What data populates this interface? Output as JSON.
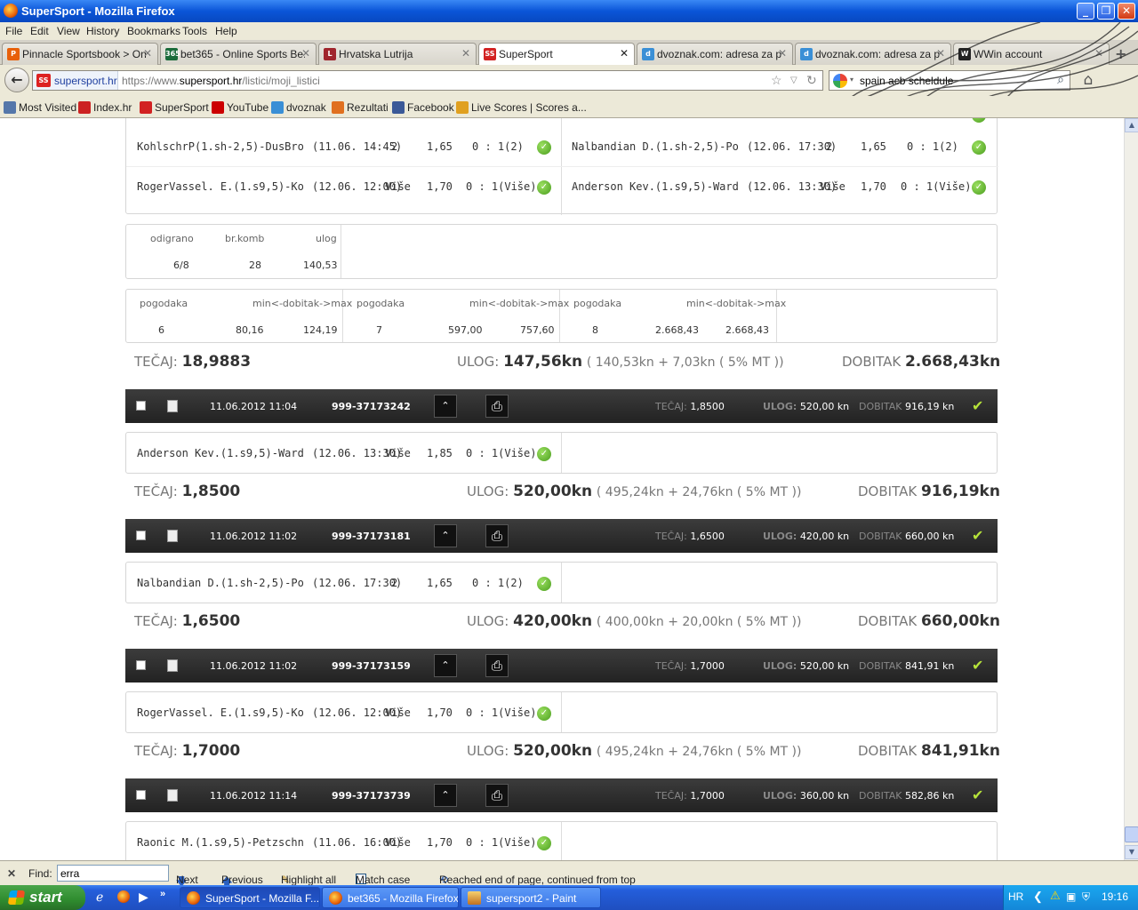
{
  "window": {
    "title": "SuperSport - Mozilla Firefox"
  },
  "menu": [
    "File",
    "Edit",
    "View",
    "History",
    "Bookmarks",
    "Tools",
    "Help"
  ],
  "tabs": [
    {
      "label": "Pinnacle Sportsbook > Onl...",
      "color": "#e8600a",
      "glyph": "P"
    },
    {
      "label": "bet365 - Online Sports Be...",
      "color": "#1a6b3a",
      "glyph": "365"
    },
    {
      "label": "Hrvatska Lutrija",
      "color": "#a0252d",
      "glyph": "L"
    },
    {
      "label": "SuperSport",
      "color": "#d22222",
      "glyph": "SS"
    },
    {
      "label": "dvoznak.com: adresa za p...",
      "color": "#3a8fd6",
      "glyph": "d"
    },
    {
      "label": "dvoznak.com: adresa za p...",
      "color": "#3a8fd6",
      "glyph": "d"
    },
    {
      "label": "WWin account",
      "color": "#222222",
      "glyph": "W"
    }
  ],
  "nav": {
    "site_name": "supersport.hr",
    "url_prefix": "https://www.",
    "url_host": "supersport.hr",
    "url_path": "/listici/moji_listici",
    "search_value": "spain acb scheldule"
  },
  "bookmarks": [
    {
      "label": "Most Visited",
      "color": "#5577aa"
    },
    {
      "label": "Index.hr",
      "color": "#cc2222"
    },
    {
      "label": "SuperSport",
      "color": "#d22222"
    },
    {
      "label": "YouTube",
      "color": "#cc0000"
    },
    {
      "label": "dvoznak",
      "color": "#3a8fd6"
    },
    {
      "label": "Rezultati",
      "color": "#e07020"
    },
    {
      "label": "Facebook",
      "color": "#3b5998"
    },
    {
      "label": "Live Scores | Scores a...",
      "color": "#e0a020"
    }
  ],
  "ticket1": {
    "matches_left": [
      {
        "event": "KohlschrP(1.sh-2,5)-DusBro",
        "time": "(11.06. 14:45)",
        "tip": "2",
        "odd": "1,65",
        "res": "0 : 1(2)"
      },
      {
        "event": "RogerVassel. E.(1.s9,5)-Ko",
        "time": "(12.06. 12:00)",
        "tip": "Više",
        "odd": "1,70",
        "res": "0 : 1(Više)"
      }
    ],
    "matches_right": [
      {
        "event": "Nalbandian D.(1.sh-2,5)-Po",
        "time": "(12.06. 17:30)",
        "tip": "2",
        "odd": "1,65",
        "res": "0 : 1(2)"
      },
      {
        "event": "Anderson Kev.(1.s9,5)-Ward",
        "time": "(12.06. 13:30)",
        "tip": "Više",
        "odd": "1,70",
        "res": "0 : 1(Više)"
      }
    ],
    "system": {
      "h_odigrano": "odigrano",
      "h_brkomb": "br.komb",
      "h_ulog": "ulog",
      "odigrano": "6/8",
      "brkomb": "28",
      "ulog": "140,53"
    },
    "wins": [
      {
        "h_pog": "pogodaka",
        "h_range": "min<-dobitak->max",
        "pog": "6",
        "min": "80,16",
        "max": "124,19"
      },
      {
        "h_pog": "pogodaka",
        "h_range": "min<-dobitak->max",
        "pog": "7",
        "min": "597,00",
        "max": "757,60"
      },
      {
        "h_pog": "pogodaka",
        "h_range": "min<-dobitak->max",
        "pog": "8",
        "min": "2.668,43",
        "max": "2.668,43"
      }
    ],
    "summary": {
      "tecaj": "18,9883",
      "ulog": "147,56kn",
      "ulog_detail": "( 140,53kn + 7,03kn ( 5% MT ))",
      "dobitak": "2.668,43kn"
    }
  },
  "labels": {
    "tecaj": "TEČAJ:",
    "ulog": "ULOG:",
    "dobitak": "DOBITAK",
    "bar_tecaj": "TEČAJ:",
    "bar_ulog": "ULOG:",
    "bar_dobitak": "DOBITAK"
  },
  "tickets": [
    {
      "date": "11.06.2012 11:04",
      "id": "999-37173242",
      "tecaj": "1,8500",
      "ulog": "520,00 kn",
      "dobitak": "916,19 kn",
      "match": {
        "event": "Anderson Kev.(1.s9,5)-Ward",
        "time": "(12.06. 13:30)",
        "tip": "Više",
        "odd": "1,85",
        "res": "0 : 1(Više)"
      },
      "summary": {
        "tecaj": "1,8500",
        "ulog": "520,00kn",
        "ulog_detail": "( 495,24kn + 24,76kn ( 5% MT ))",
        "dobitak": "916,19kn"
      }
    },
    {
      "date": "11.06.2012 11:02",
      "id": "999-37173181",
      "tecaj": "1,6500",
      "ulog": "420,00 kn",
      "dobitak": "660,00 kn",
      "match": {
        "event": "Nalbandian D.(1.sh-2,5)-Po",
        "time": "(12.06. 17:30)",
        "tip": "2",
        "odd": "1,65",
        "res": "0 : 1(2)"
      },
      "summary": {
        "tecaj": "1,6500",
        "ulog": "420,00kn",
        "ulog_detail": "( 400,00kn + 20,00kn ( 5% MT ))",
        "dobitak": "660,00kn"
      }
    },
    {
      "date": "11.06.2012 11:02",
      "id": "999-37173159",
      "tecaj": "1,7000",
      "ulog": "520,00 kn",
      "dobitak": "841,91 kn",
      "match": {
        "event": "RogerVassel. E.(1.s9,5)-Ko",
        "time": "(12.06. 12:00)",
        "tip": "Više",
        "odd": "1,70",
        "res": "0 : 1(Više)"
      },
      "summary": {
        "tecaj": "1,7000",
        "ulog": "520,00kn",
        "ulog_detail": "( 495,24kn + 24,76kn ( 5% MT ))",
        "dobitak": "841,91kn"
      }
    },
    {
      "date": "11.06.2012 11:14",
      "id": "999-37173739",
      "tecaj": "1,7000",
      "ulog": "360,00 kn",
      "dobitak": "582,86 kn",
      "match": {
        "event": "Raonic M.(1.s9,5)-Petzschn",
        "time": "(11.06. 16:00)",
        "tip": "Više",
        "odd": "1,70",
        "res": "0 : 1(Više)"
      }
    }
  ],
  "find": {
    "label": "Find:",
    "value": "erra",
    "next": "Next",
    "previous": "Previous",
    "highlight": "Highlight all",
    "match_case": "Match case",
    "status": "Reached end of page, continued from top"
  },
  "taskbar": {
    "start": "start",
    "tasks": [
      "SuperSport - Mozilla F...",
      "bet365 - Mozilla Firefox",
      "supersport2 - Paint"
    ],
    "lang": "HR",
    "clock": "19:16"
  }
}
